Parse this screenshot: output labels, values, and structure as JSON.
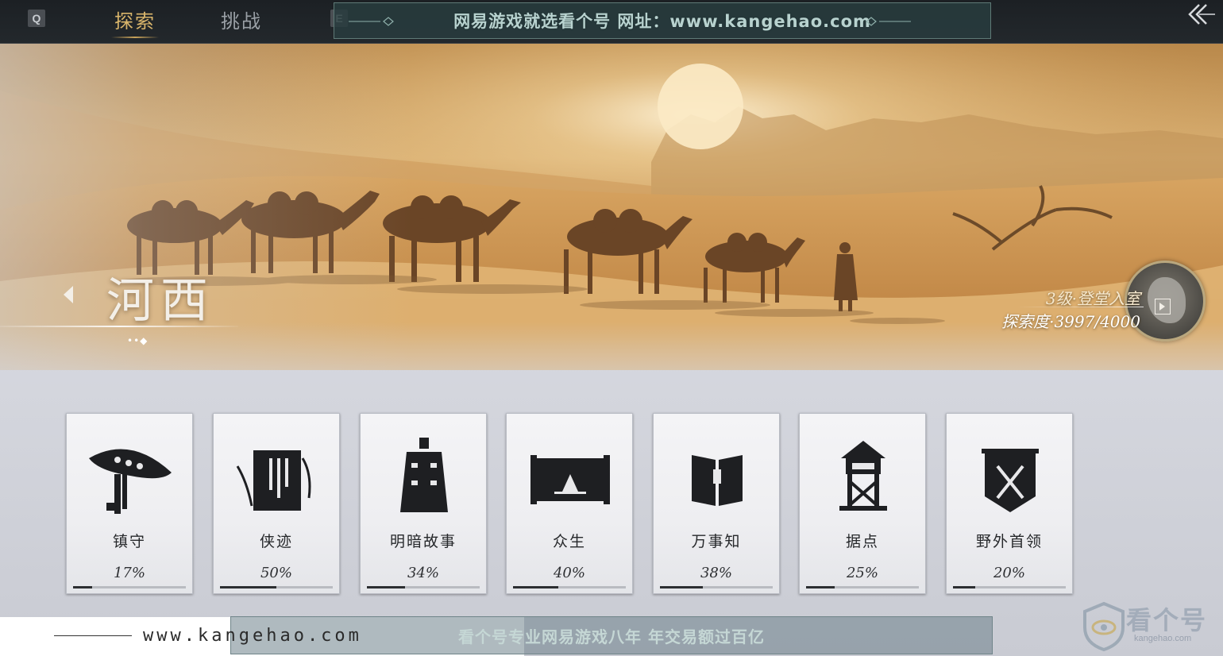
{
  "topbar": {
    "key_left": "Q",
    "key_right": "E",
    "tabs": [
      {
        "label": "探索",
        "active": true
      },
      {
        "label": "挑战",
        "active": false
      }
    ]
  },
  "watermark": {
    "top_banner": "网易游戏就选看个号  网址：www.kangehao.com",
    "bottom_banner": "看个号专业网易游戏八年  年交易额过百亿",
    "bottom_url": "www.kangehao.com",
    "logo_name": "看个号",
    "logo_sub": "kangehao.com"
  },
  "region": {
    "name": "河西",
    "page_dots": "••◆",
    "level": "3级·登堂入室",
    "exploration": "探索度·3997/4000"
  },
  "categories": [
    {
      "label": "镇守",
      "percent": "17%",
      "progress": 0.17,
      "icon": "bamboo-hat-icon"
    },
    {
      "label": "侠迹",
      "percent": "50%",
      "progress": 0.5,
      "icon": "book-icon"
    },
    {
      "label": "明暗故事",
      "percent": "34%",
      "progress": 0.34,
      "icon": "bell-icon"
    },
    {
      "label": "众生",
      "percent": "40%",
      "progress": 0.4,
      "icon": "scroll-painting-icon"
    },
    {
      "label": "万事知",
      "percent": "38%",
      "progress": 0.38,
      "icon": "open-book-icon"
    },
    {
      "label": "据点",
      "percent": "25%",
      "progress": 0.25,
      "icon": "watchtower-icon"
    },
    {
      "label": "野外首领",
      "percent": "20%",
      "progress": 0.2,
      "icon": "crossed-swords-banner-icon"
    }
  ],
  "colors": {
    "active_tab": "#d9b56b",
    "topbar_bg": "#1c2024",
    "card_ink": "#26282b"
  }
}
